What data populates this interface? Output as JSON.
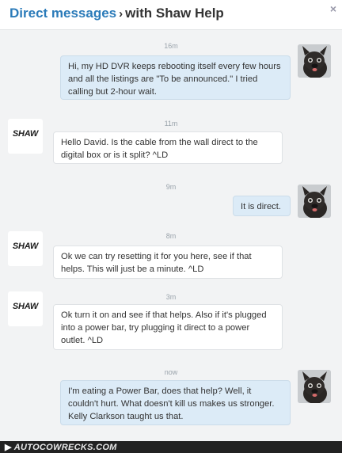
{
  "header": {
    "link_label": "Direct messages",
    "separator": "›",
    "conversation_title": "with Shaw Help",
    "close_glyph": "×"
  },
  "messages": [
    {
      "time": "16m",
      "sender": "me",
      "text": "Hi, my HD DVR keeps rebooting itself every few hours and all the listings are \"To be announced.\" I tried calling but 2-hour wait."
    },
    {
      "time": "11m",
      "sender": "shaw",
      "text": "Hello David. Is the cable from the wall direct to the digital box or is it split? ^LD"
    },
    {
      "time": "9m",
      "sender": "me",
      "text": "It is direct."
    },
    {
      "time": "8m",
      "sender": "shaw",
      "text": "Ok we can try resetting it for you here, see if that helps. This will just be a minute. ^LD"
    },
    {
      "time": "3m",
      "sender": "shaw",
      "text": "Ok turn it on and see if that helps. Also if it's plugged into a power bar, try plugging it direct to a power outlet. ^LD"
    },
    {
      "time": "now",
      "sender": "me",
      "text": "I'm eating a Power Bar, does that help? Well, it couldn't hurt. What doesn't kill us makes us stronger. Kelly Clarkson taught us that."
    }
  ],
  "shaw_logo_text": "SHAW",
  "footer": {
    "watermark": "AUTOCOWRECKS.COM"
  },
  "colors": {
    "link": "#2b7bb9",
    "outgoing_bubble": "#dcebf7",
    "incoming_bubble": "#ffffff",
    "background": "#f2f3f4"
  },
  "icons": {
    "user_avatar": "dog-photo-avatar",
    "shaw_avatar": "shaw-logo-avatar",
    "close": "close-icon"
  }
}
